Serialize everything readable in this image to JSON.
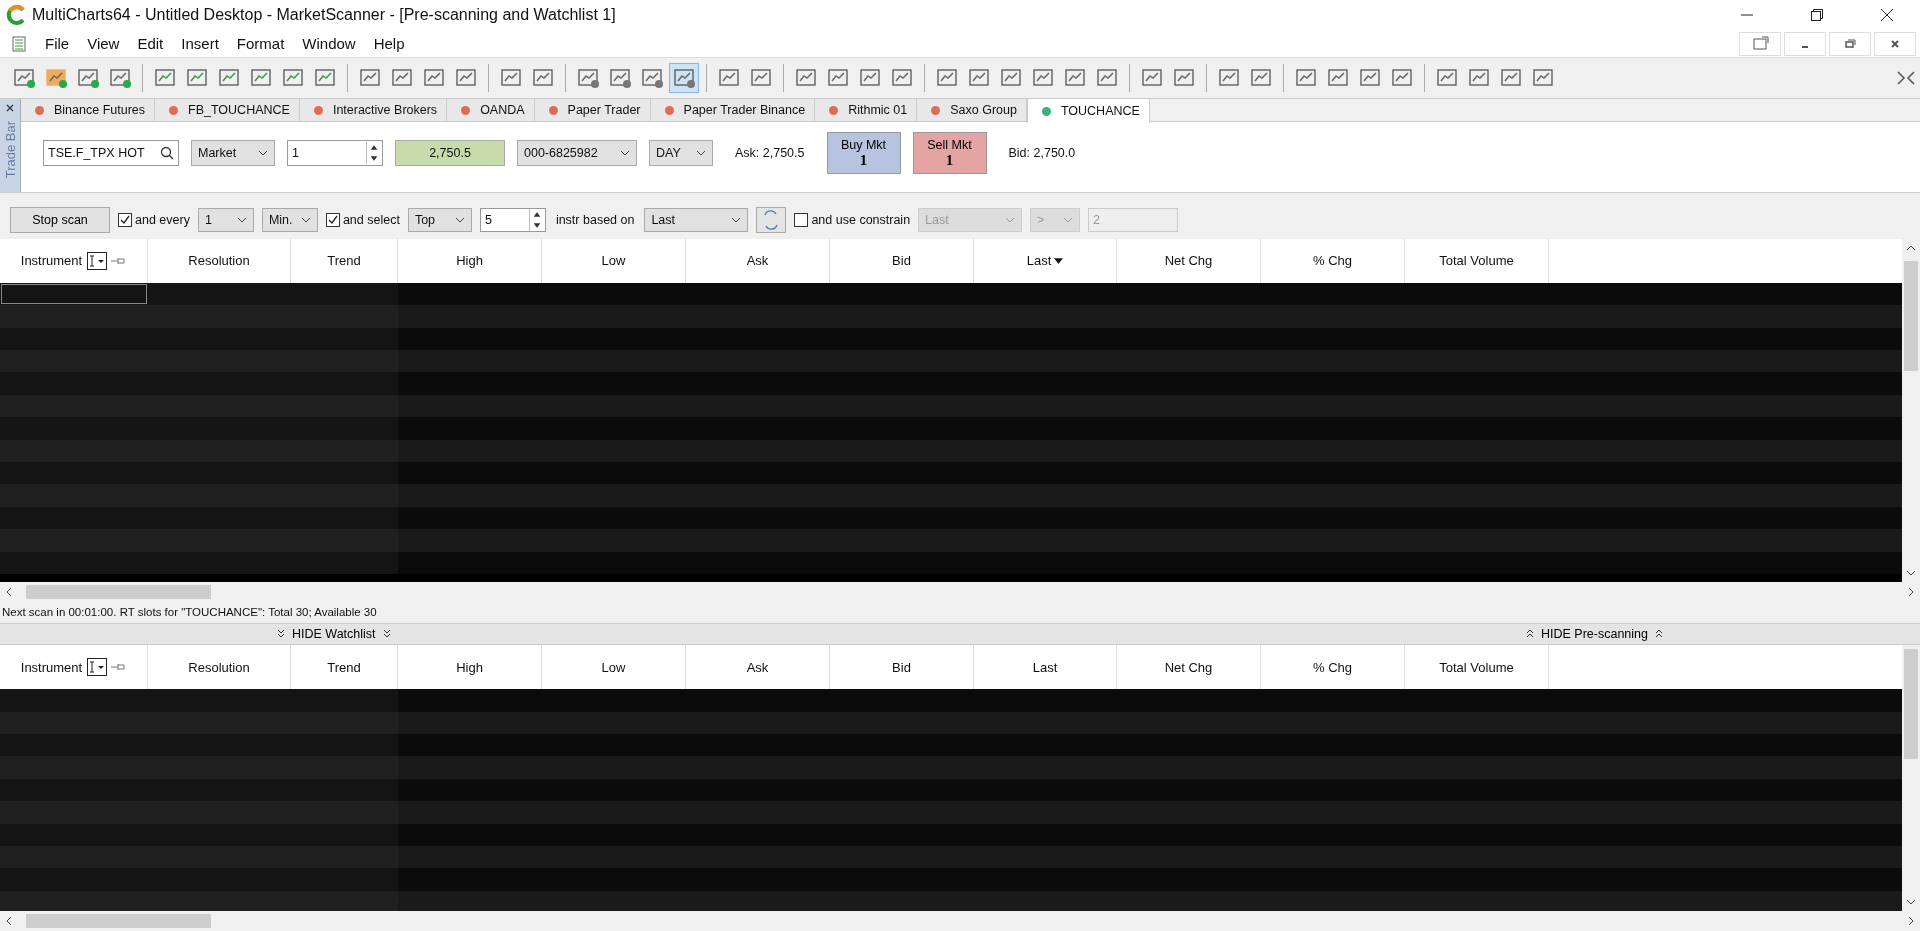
{
  "window": {
    "title": "MultiCharts64 - Untitled Desktop - MarketScanner - [Pre-scanning and Watchlist 1]"
  },
  "menu": [
    "File",
    "View",
    "Edit",
    "Insert",
    "Format",
    "Window",
    "Help"
  ],
  "trade_bar": {
    "side_label": "Trade Bar",
    "broker_tabs": [
      {
        "label": "Binance Futures",
        "color": "#e06b5a",
        "selected": false
      },
      {
        "label": "FB_TOUCHANCE",
        "color": "#e06b5a",
        "selected": false
      },
      {
        "label": "Interactive Brokers",
        "color": "#e06b5a",
        "selected": false
      },
      {
        "label": "OANDA",
        "color": "#e06b5a",
        "selected": false
      },
      {
        "label": "Paper Trader",
        "color": "#e06b5a",
        "selected": false
      },
      {
        "label": "Paper Trader Binance",
        "color": "#e06b5a",
        "selected": false
      },
      {
        "label": "Rithmic 01",
        "color": "#e06b5a",
        "selected": false
      },
      {
        "label": "Saxo Group",
        "color": "#e06b5a",
        "selected": false
      },
      {
        "label": "TOUCHANCE",
        "color": "#3bb27a",
        "selected": true
      }
    ],
    "symbol": "TSE.F_TPX HOT",
    "order_type": "Market",
    "quantity": "1",
    "price": "2,750.5",
    "account": "000-6825982",
    "time_in_force": "DAY",
    "ask": "Ask: 2,750.5",
    "buy": {
      "label": "Buy Mkt",
      "quantity": "1"
    },
    "sell": {
      "label": "Sell Mkt",
      "quantity": "1"
    },
    "bid": "Bid: 2,750.0"
  },
  "scan_bar": {
    "stop_button": "Stop scan",
    "every": {
      "label": "and every",
      "checked": true
    },
    "interval": "1",
    "unit": "Min.",
    "select": {
      "label": "and select",
      "checked": true
    },
    "rank": "Top",
    "count": "5",
    "based_on_label": "instr based on",
    "based_on": "Last",
    "constrain": {
      "label": "and use constrain",
      "checked": false
    },
    "constrain_field": "Last",
    "constrain_operator": ">",
    "constrain_value": "2"
  },
  "prescan_table": {
    "columns": [
      {
        "label": "Instrument",
        "sorted": false
      },
      {
        "label": "Resolution",
        "sorted": false
      },
      {
        "label": "Trend",
        "sorted": false
      },
      {
        "label": "High",
        "sorted": false
      },
      {
        "label": "Low",
        "sorted": false
      },
      {
        "label": "Ask",
        "sorted": false
      },
      {
        "label": "Bid",
        "sorted": false
      },
      {
        "label": "Last",
        "sorted": true
      },
      {
        "label": "Net Chg",
        "sorted": false
      },
      {
        "label": "% Chg",
        "sorted": false
      },
      {
        "label": "Total Volume",
        "sorted": false
      }
    ]
  },
  "status": "Next scan in 00:01:00. RT slots for \"TOUCHANCE\": Total 30; Available 30",
  "hide_watchlist": "HIDE Watchlist",
  "hide_prescanning": "HIDE Pre-scanning",
  "watchlist_table": {
    "columns": [
      {
        "label": "Instrument",
        "sorted": false
      },
      {
        "label": "Resolution",
        "sorted": false
      },
      {
        "label": "Trend",
        "sorted": false
      },
      {
        "label": "High",
        "sorted": false
      },
      {
        "label": "Low",
        "sorted": false
      },
      {
        "label": "Ask",
        "sorted": false
      },
      {
        "label": "Bid",
        "sorted": false
      },
      {
        "label": "Last",
        "sorted": false
      },
      {
        "label": "Net Chg",
        "sorted": false
      },
      {
        "label": "% Chg",
        "sorted": false
      },
      {
        "label": "Total Volume",
        "sorted": false
      }
    ]
  }
}
